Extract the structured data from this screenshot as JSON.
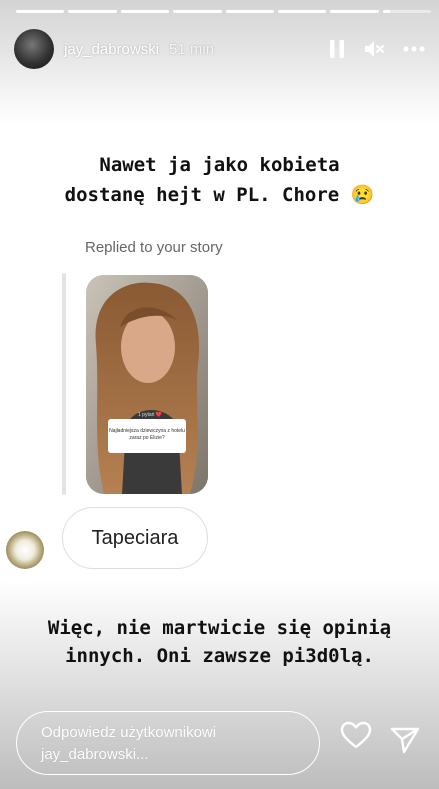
{
  "story": {
    "username": "jay_dabrowski",
    "time": "51 min",
    "segments": 8,
    "active_segment_progress": 0.15
  },
  "captions": {
    "top_line1": "Nawet ja jako kobieta",
    "top_line2": "dostanę hejt w PL. Chore 😢",
    "bottom_line1": "Więc, nie martwicie się opinią",
    "bottom_line2": "innych. Oni zawsze pi3d0lą."
  },
  "reply": {
    "replied_label": "Replied to your story",
    "thumbnail_q_title": "1 pytań ❤️",
    "thumbnail_q_text": "Najładniejsza dziewczyna z hotelu zaraz po Elizie?",
    "message": "Tapeciara"
  },
  "composer": {
    "placeholder": "Odpowiedz użytkownikowi jay_dabrowski..."
  },
  "icons": {
    "pause": "pause-icon",
    "mute": "mute-icon",
    "more": "more-icon",
    "like": "heart-icon",
    "send": "send-icon"
  }
}
